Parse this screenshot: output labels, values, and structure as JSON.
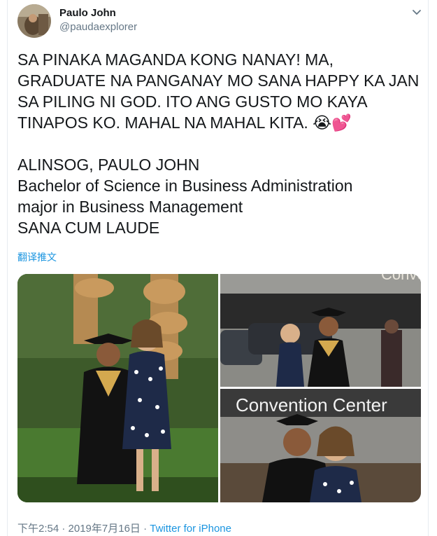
{
  "author": {
    "name": "Paulo John",
    "handle": "@paudaexplorer"
  },
  "tweet": {
    "paragraph1": "SA PINAKA MAGANDA KONG NANAY! MA, GRADUATE NA PANGANAY MO SANA HAPPY KA JAN SA PILING NI GOD. ITO ANG GUSTO MO KAYA TINAPOS KO. MAHAL NA MAHAL KITA. 😭💕",
    "line1": "ALINSOG, PAULO JOHN",
    "line2": "Bachelor of Science in Business Administration",
    "line3": "major in Business Management",
    "line4": "SANA CUM LAUDE"
  },
  "translate_label": "翻译推文",
  "media": {
    "sign_text": "Convention Center",
    "sign_text_top": "Convention"
  },
  "meta": {
    "timestamp": "下午2:54 · 2019年7月16日 · ",
    "source": "Twitter for iPhone"
  },
  "colors": {
    "link": "#1b95e0",
    "text": "#14171a",
    "secondary": "#657786"
  },
  "icons": {
    "caret": "chevron-down-icon",
    "avatar": "avatar"
  }
}
